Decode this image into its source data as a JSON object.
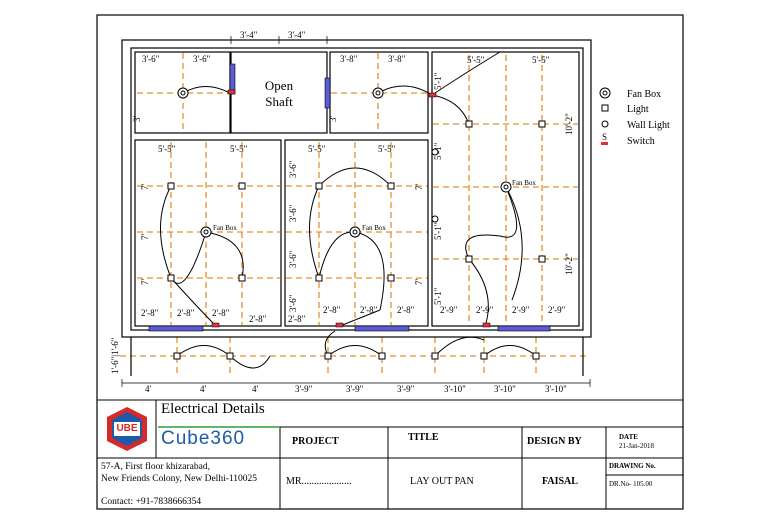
{
  "plan": {
    "open_shaft_label": [
      "Open",
      "Shaft"
    ],
    "fan_box_tag": "Fan Box",
    "dims": {
      "top_shaft": [
        "3'-4\"",
        "3'-4\""
      ],
      "room1_top": [
        "3'-6\"",
        "3'-6\""
      ],
      "room1_side": "3'",
      "room2_top": [
        "3'-8\"",
        "3'-8\""
      ],
      "room2_side": "3'",
      "room3_top": [
        "5'-5\"",
        "5'-5\""
      ],
      "room3_side": [
        "10'-2\"",
        "10'-2\""
      ],
      "room3_left": [
        "5'-1\"",
        "5'-1\"",
        "5'-1\"",
        "5'-1\""
      ],
      "room3_bottom": [
        "2'-9\"",
        "2'-9\"",
        "2'-9\"",
        "2'-9\""
      ],
      "room4_top": [
        "5'-5\"",
        "5'-5\""
      ],
      "room4_side": [
        "7'",
        "7'",
        "7'"
      ],
      "room4_bottom": [
        "2'-8\"",
        "2'-8\"",
        "2'-8\"",
        "2'-8\""
      ],
      "room5_top": [
        "5'-5\"",
        "5'-5\""
      ],
      "room5_left": [
        "3'-6\"",
        "3'-6\"",
        "3'-6\"",
        "3'-6\""
      ],
      "room5_side": [
        "7'",
        "7'"
      ],
      "room5_bottom": [
        "2'-8\"",
        "2'-8\"",
        "2'-8\"",
        "2'-8\""
      ],
      "left_corridor": "1'-6\"|1'-6\"",
      "bottom": [
        "4'",
        "4'",
        "4'",
        "3'-9\"",
        "3'-9\"",
        "3'-9\"",
        "3'-10\"",
        "3'-10\"",
        "3'-10\""
      ]
    }
  },
  "legend": {
    "items": [
      {
        "label": "Fan Box",
        "icon": "fan-box-icon"
      },
      {
        "label": "Light",
        "icon": "light-icon"
      },
      {
        "label": "Wall Light",
        "icon": "wall-light-icon"
      },
      {
        "label": "Switch",
        "icon": "switch-icon",
        "glyph": "S"
      }
    ]
  },
  "title_block": {
    "heading": "Electrical Details",
    "logo_text": "UBE",
    "brand": "Cube360",
    "address": [
      "57-A, First floor khizarabad,",
      "New Friends Colony, New Delhi-110025"
    ],
    "contact": "Contact: +91-7838666354",
    "project_label": "PROJECT",
    "project_value": "MR....................",
    "title_label": "TITLE",
    "title_value": "LAY OUT PAN",
    "design_label": "DESIGN BY",
    "design_value": "FAISAL",
    "date_label": "DATE",
    "date_value": "21-Jan-2018",
    "drawing_label": "DRAWING No.",
    "drawing_value": "DR.No- 105.00"
  },
  "colors": {
    "wall": "#000000",
    "grid": "#e8902a",
    "window": "#5b5bd6",
    "switch": "#e0303a",
    "brand": "#1f5aa8",
    "logo_red": "#d42a2a",
    "header_line": "#2a9d3a"
  }
}
